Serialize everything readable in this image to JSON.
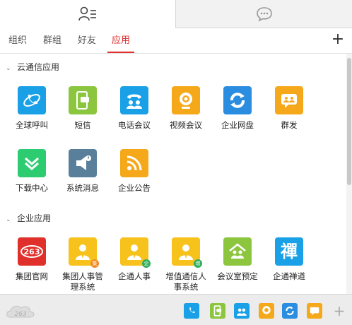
{
  "top_tabs": {
    "contacts_icon": "contacts-icon",
    "chat_icon": "chat-bubble-icon"
  },
  "subtabs": [
    "组织",
    "群组",
    "好友",
    "应用"
  ],
  "active_subtab": "应用",
  "sections": [
    {
      "title": "云通信应用",
      "apps": [
        {
          "label": "全球呼叫",
          "icon": "global-call-icon",
          "color": "#1aa0e6"
        },
        {
          "label": "短信",
          "icon": "sms-icon",
          "color": "#8cc63f"
        },
        {
          "label": "电话会议",
          "icon": "phone-conference-icon",
          "color": "#1aa0e6"
        },
        {
          "label": "视频会议",
          "icon": "video-conference-icon",
          "color": "#f6a81b"
        },
        {
          "label": "企业网盘",
          "icon": "cloud-drive-icon",
          "color": "#2b8de0"
        },
        {
          "label": "群发",
          "icon": "group-send-icon",
          "color": "#f6a81b"
        },
        {
          "label": "下载中心",
          "icon": "download-center-icon",
          "color": "#2ecc71"
        },
        {
          "label": "系统消息",
          "icon": "system-message-icon",
          "color": "#5a7f9a"
        },
        {
          "label": "企业公告",
          "icon": "rss-icon",
          "color": "#f6a81b"
        }
      ]
    },
    {
      "title": "企业应用",
      "apps": [
        {
          "label": "集团官网",
          "icon": "website-263-icon",
          "color": "#e0302c"
        },
        {
          "label": "集团人事管理系统",
          "icon": "hr-system-icon",
          "color": "#f6c21b"
        },
        {
          "label": "企通人事",
          "icon": "hr-icon",
          "color": "#f6c21b"
        },
        {
          "label": "增值通信人事系统",
          "icon": "hr-vas-icon",
          "color": "#f6c21b"
        },
        {
          "label": "会议室预定",
          "icon": "meeting-room-icon",
          "color": "#8cc63f"
        },
        {
          "label": "企通禅道",
          "icon": "zentao-icon",
          "color": "#1aa0e6"
        }
      ]
    }
  ],
  "hr_labels": {
    "a1": "集团人事管",
    "a2": "理系统",
    "b1": "增值通信人",
    "b2": "事系统"
  },
  "bottom_logo": "263",
  "bottom_icons": [
    {
      "icon": "global-call-icon",
      "color": "#1aa0e6"
    },
    {
      "icon": "sms-icon",
      "color": "#8cc63f"
    },
    {
      "icon": "phone-conference-icon",
      "color": "#1aa0e6"
    },
    {
      "icon": "video-conference-icon",
      "color": "#f6a81b"
    },
    {
      "icon": "cloud-drive-icon",
      "color": "#2b8de0"
    },
    {
      "icon": "group-send-icon",
      "color": "#f6a81b"
    },
    {
      "icon": "add-icon",
      "color": "#aaaaaa"
    }
  ],
  "badges": {
    "ji": "集",
    "qi": "企",
    "zeng": "增"
  },
  "zentao_glyph": "禪"
}
